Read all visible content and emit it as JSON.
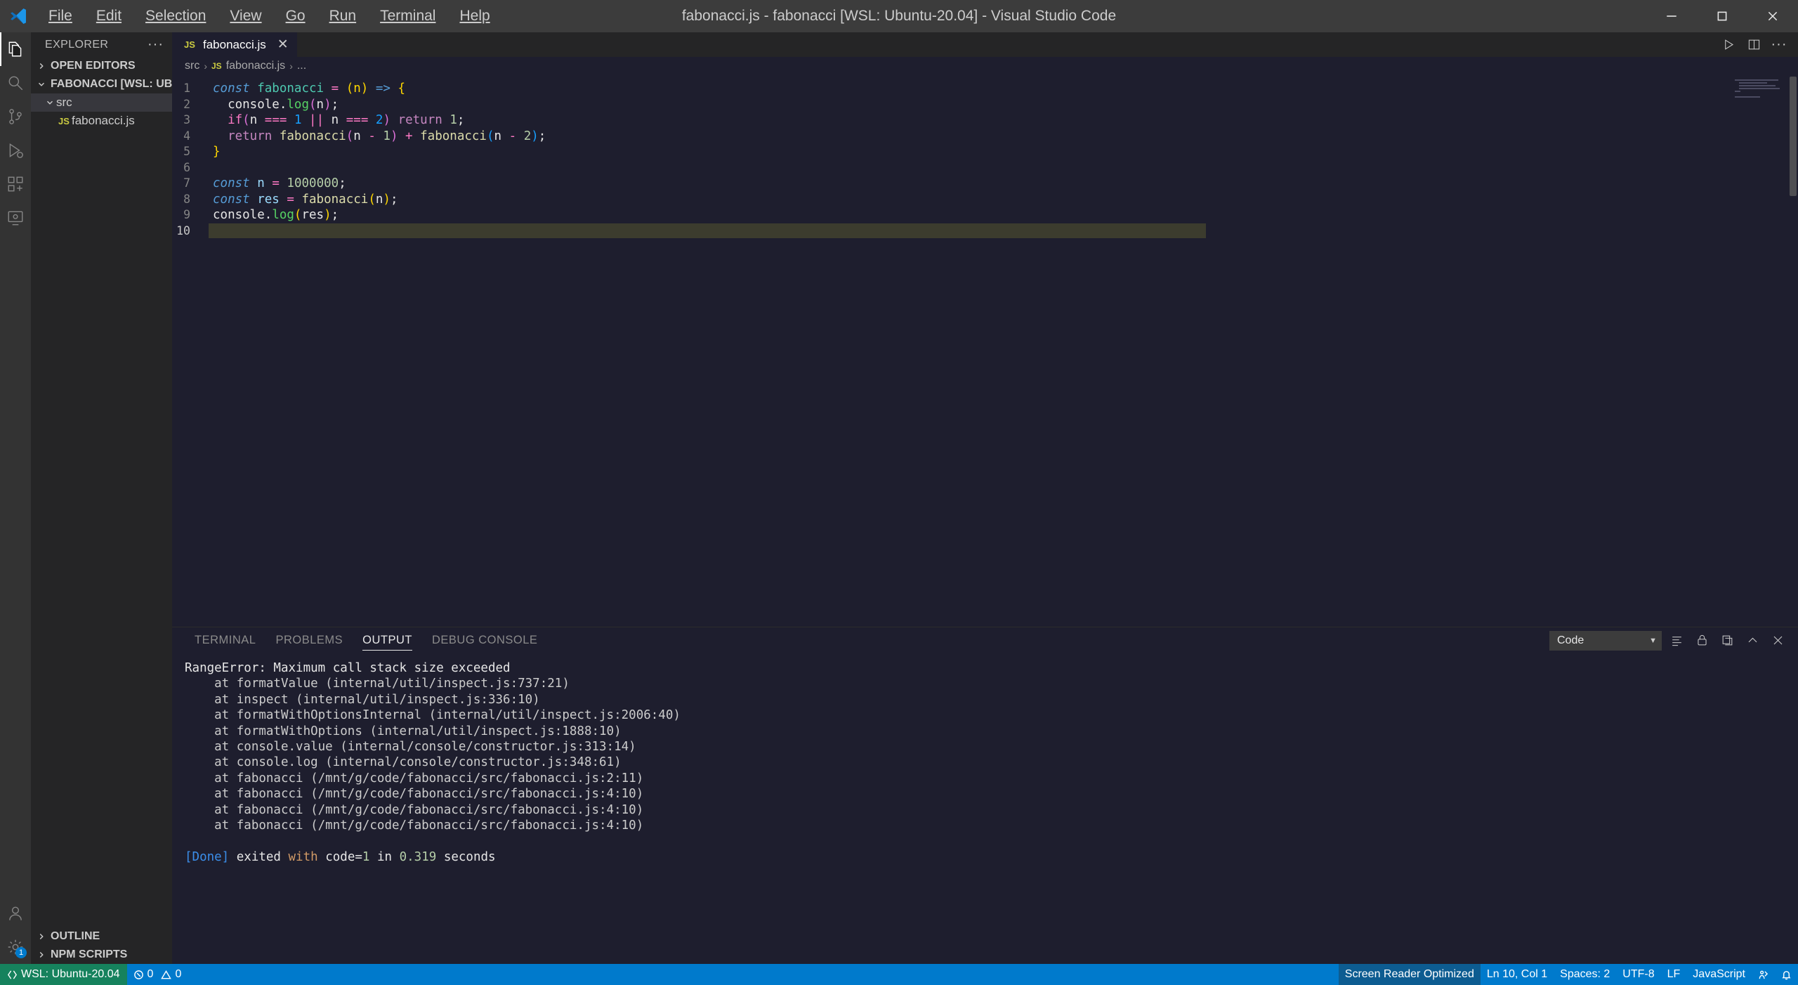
{
  "titlebar": {
    "title": "fabonacci.js - fabonacci [WSL: Ubuntu-20.04] - Visual Studio Code",
    "menu": [
      {
        "label": "File",
        "accel": "F"
      },
      {
        "label": "Edit",
        "accel": "E"
      },
      {
        "label": "Selection",
        "accel": "S"
      },
      {
        "label": "View",
        "accel": "V"
      },
      {
        "label": "Go",
        "accel": "G"
      },
      {
        "label": "Run",
        "accel": "R"
      },
      {
        "label": "Terminal",
        "accel": "T"
      },
      {
        "label": "Help",
        "accel": "H"
      }
    ],
    "window_controls": [
      "minimize",
      "maximize",
      "close"
    ]
  },
  "activitybar": {
    "items": [
      {
        "name": "explorer",
        "icon": "files-icon",
        "active": true
      },
      {
        "name": "search",
        "icon": "search-icon",
        "active": false
      },
      {
        "name": "source-control",
        "icon": "source-control-icon",
        "active": false
      },
      {
        "name": "run-and-debug",
        "icon": "debug-icon",
        "active": false
      },
      {
        "name": "extensions",
        "icon": "extensions-icon",
        "active": false
      },
      {
        "name": "remote-explorer",
        "icon": "remote-explorer-icon",
        "active": false
      }
    ],
    "bottom": [
      {
        "name": "accounts",
        "icon": "account-icon"
      },
      {
        "name": "manage",
        "icon": "gear-icon",
        "badge": "1"
      }
    ]
  },
  "sidebar": {
    "title": "EXPLORER",
    "more_label": "···",
    "sections": [
      {
        "label": "OPEN EDITORS",
        "expanded": false
      },
      {
        "label": "FABONACCI [WSL: UBUNT...",
        "expanded": true
      }
    ],
    "tree": [
      {
        "label": "src",
        "type": "folder",
        "expanded": true,
        "selected": true
      },
      {
        "label": "fabonacci.js",
        "type": "file",
        "icon": "JS",
        "selected": false
      }
    ],
    "bottom_sections": [
      {
        "label": "OUTLINE",
        "expanded": false
      },
      {
        "label": "NPM SCRIPTS",
        "expanded": false
      }
    ]
  },
  "editor": {
    "tabs": [
      {
        "label": "fabonacci.js",
        "icon": "JS",
        "active": true,
        "close": "✕"
      }
    ],
    "tab_actions": [
      "run-icon",
      "split-editor-icon",
      "more-actions-icon"
    ],
    "breadcrumb": [
      "src",
      "fabonacci.js",
      "..."
    ],
    "breadcrumb_icon": "JS",
    "current_line": 10,
    "lines": [
      {
        "n": 1,
        "tokens": [
          {
            "t": "const",
            "c": "t-kw"
          },
          {
            "t": " ",
            "c": "t-plain"
          },
          {
            "t": "fabonacci",
            "c": "t-fn"
          },
          {
            "t": " ",
            "c": "t-plain"
          },
          {
            "t": "=",
            "c": "t-op"
          },
          {
            "t": " ",
            "c": "t-plain"
          },
          {
            "t": "(",
            "c": "t-par"
          },
          {
            "t": "n",
            "c": "t-par"
          },
          {
            "t": ")",
            "c": "t-par"
          },
          {
            "t": " ",
            "c": "t-plain"
          },
          {
            "t": "=>",
            "c": "t-arrow"
          },
          {
            "t": " ",
            "c": "t-plain"
          },
          {
            "t": "{",
            "c": "t-par"
          }
        ]
      },
      {
        "n": 2,
        "tokens": [
          {
            "t": "  ",
            "c": "t-plain"
          },
          {
            "t": "console",
            "c": "t-plain"
          },
          {
            "t": ".",
            "c": "t-plain"
          },
          {
            "t": "log",
            "c": "t-prop"
          },
          {
            "t": "(",
            "c": "t-par2"
          },
          {
            "t": "n",
            "c": "t-plain"
          },
          {
            "t": ")",
            "c": "t-par2"
          },
          {
            "t": ";",
            "c": "t-plain"
          }
        ]
      },
      {
        "n": 3,
        "tokens": [
          {
            "t": "  ",
            "c": "t-plain"
          },
          {
            "t": "if",
            "c": "t-op"
          },
          {
            "t": "(",
            "c": "t-par2"
          },
          {
            "t": "n",
            "c": "t-plain"
          },
          {
            "t": " ",
            "c": "t-plain"
          },
          {
            "t": "===",
            "c": "t-op"
          },
          {
            "t": " ",
            "c": "t-plain"
          },
          {
            "t": "1",
            "c": "t-par3"
          },
          {
            "t": " ",
            "c": "t-plain"
          },
          {
            "t": "||",
            "c": "t-op"
          },
          {
            "t": " ",
            "c": "t-plain"
          },
          {
            "t": "n",
            "c": "t-plain"
          },
          {
            "t": " ",
            "c": "t-plain"
          },
          {
            "t": "===",
            "c": "t-op"
          },
          {
            "t": " ",
            "c": "t-plain"
          },
          {
            "t": "2",
            "c": "t-par3"
          },
          {
            "t": ")",
            "c": "t-par2"
          },
          {
            "t": " ",
            "c": "t-plain"
          },
          {
            "t": "return",
            "c": "t-ctl"
          },
          {
            "t": " ",
            "c": "t-plain"
          },
          {
            "t": "1",
            "c": "t-num"
          },
          {
            "t": ";",
            "c": "t-plain"
          }
        ]
      },
      {
        "n": 4,
        "tokens": [
          {
            "t": "  ",
            "c": "t-plain"
          },
          {
            "t": "return",
            "c": "t-ctl"
          },
          {
            "t": " ",
            "c": "t-plain"
          },
          {
            "t": "fabonacci",
            "c": "t-func"
          },
          {
            "t": "(",
            "c": "t-par2"
          },
          {
            "t": "n",
            "c": "t-plain"
          },
          {
            "t": " ",
            "c": "t-plain"
          },
          {
            "t": "-",
            "c": "t-op"
          },
          {
            "t": " ",
            "c": "t-plain"
          },
          {
            "t": "1",
            "c": "t-num"
          },
          {
            "t": ")",
            "c": "t-par2"
          },
          {
            "t": " ",
            "c": "t-plain"
          },
          {
            "t": "+",
            "c": "t-op"
          },
          {
            "t": " ",
            "c": "t-plain"
          },
          {
            "t": "fabonacci",
            "c": "t-func"
          },
          {
            "t": "(",
            "c": "t-par3"
          },
          {
            "t": "n",
            "c": "t-plain"
          },
          {
            "t": " ",
            "c": "t-plain"
          },
          {
            "t": "-",
            "c": "t-op"
          },
          {
            "t": " ",
            "c": "t-plain"
          },
          {
            "t": "2",
            "c": "t-num"
          },
          {
            "t": ")",
            "c": "t-par3"
          },
          {
            "t": ";",
            "c": "t-plain"
          }
        ]
      },
      {
        "n": 5,
        "tokens": [
          {
            "t": "}",
            "c": "t-par"
          }
        ]
      },
      {
        "n": 6,
        "tokens": []
      },
      {
        "n": 7,
        "tokens": [
          {
            "t": "const",
            "c": "t-kw"
          },
          {
            "t": " ",
            "c": "t-plain"
          },
          {
            "t": "n",
            "c": "t-var"
          },
          {
            "t": " ",
            "c": "t-plain"
          },
          {
            "t": "=",
            "c": "t-op"
          },
          {
            "t": " ",
            "c": "t-plain"
          },
          {
            "t": "1000000",
            "c": "t-num"
          },
          {
            "t": ";",
            "c": "t-plain"
          }
        ]
      },
      {
        "n": 8,
        "tokens": [
          {
            "t": "const",
            "c": "t-kw"
          },
          {
            "t": " ",
            "c": "t-plain"
          },
          {
            "t": "res",
            "c": "t-var"
          },
          {
            "t": " ",
            "c": "t-plain"
          },
          {
            "t": "=",
            "c": "t-op"
          },
          {
            "t": " ",
            "c": "t-plain"
          },
          {
            "t": "fabonacci",
            "c": "t-func"
          },
          {
            "t": "(",
            "c": "t-par"
          },
          {
            "t": "n",
            "c": "t-plain"
          },
          {
            "t": ")",
            "c": "t-par"
          },
          {
            "t": ";",
            "c": "t-plain"
          }
        ]
      },
      {
        "n": 9,
        "tokens": [
          {
            "t": "console",
            "c": "t-plain"
          },
          {
            "t": ".",
            "c": "t-plain"
          },
          {
            "t": "log",
            "c": "t-prop"
          },
          {
            "t": "(",
            "c": "t-par"
          },
          {
            "t": "res",
            "c": "t-plain"
          },
          {
            "t": ")",
            "c": "t-par"
          },
          {
            "t": ";",
            "c": "t-plain"
          }
        ]
      },
      {
        "n": 10,
        "tokens": []
      }
    ]
  },
  "panel": {
    "tabs": [
      {
        "label": "TERMINAL",
        "active": false
      },
      {
        "label": "PROBLEMS",
        "active": false
      },
      {
        "label": "OUTPUT",
        "active": true
      },
      {
        "label": "DEBUG CONSOLE",
        "active": false
      }
    ],
    "channel_select": {
      "value": "Code",
      "caret": "⌄"
    },
    "actions": [
      "clear-output-icon",
      "lock-icon",
      "open-in-editor-icon",
      "chevron-up-icon",
      "close-icon"
    ],
    "output": [
      {
        "text": "RangeError: Maximum call stack size exceeded",
        "cls": "o-err"
      },
      {
        "text": "    at formatValue (internal/util/inspect.js:737:21)",
        "cls": "o-at"
      },
      {
        "text": "    at inspect (internal/util/inspect.js:336:10)",
        "cls": "o-at"
      },
      {
        "text": "    at formatWithOptionsInternal (internal/util/inspect.js:2006:40)",
        "cls": "o-at"
      },
      {
        "text": "    at formatWithOptions (internal/util/inspect.js:1888:10)",
        "cls": "o-at"
      },
      {
        "text": "    at console.value (internal/console/constructor.js:313:14)",
        "cls": "o-at"
      },
      {
        "text": "    at console.log (internal/console/constructor.js:348:61)",
        "cls": "o-at"
      },
      {
        "text": "    at fabonacci (/mnt/g/code/fabonacci/src/fabonacci.js:2:11)",
        "cls": "o-at"
      },
      {
        "text": "    at fabonacci (/mnt/g/code/fabonacci/src/fabonacci.js:4:10)",
        "cls": "o-at"
      },
      {
        "text": "    at fabonacci (/mnt/g/code/fabonacci/src/fabonacci.js:4:10)",
        "cls": "o-at"
      },
      {
        "text": "    at fabonacci (/mnt/g/code/fabonacci/src/fabonacci.js:4:10)",
        "cls": "o-at"
      },
      {
        "text": "",
        "cls": "o-at"
      },
      {
        "text": "DONE_LINE",
        "cls": "o-done"
      }
    ],
    "done_line": {
      "prefix": "[Done]",
      "word1": " exited ",
      "with": "with",
      "code_label": " code=",
      "code": "1",
      "in_word": " in ",
      "seconds": "0.319",
      "unit": " seconds"
    }
  },
  "statusbar": {
    "remote": {
      "label": "WSL: Ubuntu-20.04",
      "icon": "remote-icon"
    },
    "problems": {
      "errors": "0",
      "warnings": "0",
      "error_icon": "error-circle-icon",
      "warning_icon": "warning-triangle-icon"
    },
    "right": [
      {
        "label": "Screen Reader Optimized",
        "name": "screen-reader-status",
        "dark": true
      },
      {
        "label": "Ln 10, Col 1",
        "name": "cursor-position",
        "dark": false
      },
      {
        "label": "Spaces: 2",
        "name": "indentation",
        "dark": false
      },
      {
        "label": "UTF-8",
        "name": "encoding",
        "dark": false
      },
      {
        "label": "LF",
        "name": "eol",
        "dark": false
      },
      {
        "label": "JavaScript",
        "name": "language-mode",
        "dark": false
      }
    ],
    "icons": [
      "feedback-icon",
      "bell-icon"
    ]
  },
  "colors": {
    "accent": "#007acc",
    "remote_green": "#16825d",
    "editor_bg": "#1e1e2e",
    "sidebar_bg": "#252526",
    "titlebar_bg": "#3c3c3c"
  }
}
